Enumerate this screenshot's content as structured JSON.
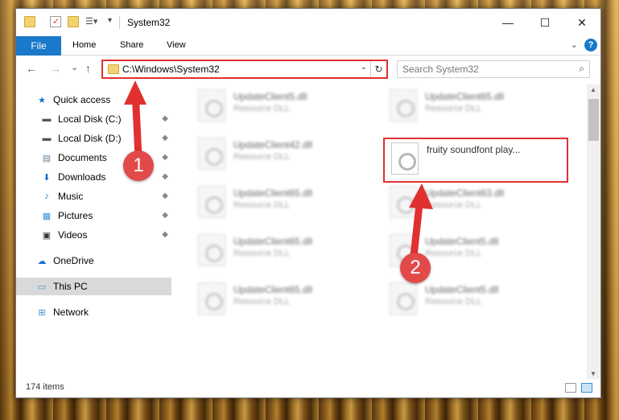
{
  "window": {
    "title": "System32",
    "controls": {
      "minimize": "—",
      "maximize": "☐",
      "close": "✕"
    }
  },
  "ribbon": {
    "tabs": {
      "file": "File",
      "home": "Home",
      "share": "Share",
      "view": "View"
    },
    "expand_glyph": "⌄",
    "help_glyph": "?"
  },
  "navigation": {
    "back": "←",
    "forward": "→",
    "recent": "⌄",
    "up": "↑",
    "address": "C:\\Windows\\System32",
    "address_dropdown": "⌄",
    "refresh": "↻",
    "search_placeholder": "Search System32",
    "search_glyph": "⌕"
  },
  "sidebar": {
    "items": [
      {
        "label": "Quick access",
        "icon": "star-icon",
        "glyph": "★",
        "color": "#1c6fd1"
      },
      {
        "label": "Local Disk (C:)",
        "icon": "drive-icon",
        "glyph": "▬",
        "color": "#555555",
        "pinned": true
      },
      {
        "label": "Local Disk (D:)",
        "icon": "drive-icon",
        "glyph": "▬",
        "color": "#555555",
        "pinned": true
      },
      {
        "label": "Documents",
        "icon": "document-icon",
        "glyph": "▤",
        "color": "#6a7fa0",
        "pinned": true
      },
      {
        "label": "Downloads",
        "icon": "download-icon",
        "glyph": "⬇",
        "color": "#1c6fd1",
        "pinned": true
      },
      {
        "label": "Music",
        "icon": "music-icon",
        "glyph": "♪",
        "color": "#1c6fd1",
        "pinned": true
      },
      {
        "label": "Pictures",
        "icon": "pictures-icon",
        "glyph": "▦",
        "color": "#3a8fd0",
        "pinned": true
      },
      {
        "label": "Videos",
        "icon": "video-icon",
        "glyph": "▣",
        "color": "#333333",
        "pinned": true
      },
      {
        "label": "OneDrive",
        "icon": "cloud-icon",
        "glyph": "☁",
        "color": "#1c6fd1"
      },
      {
        "label": "This PC",
        "icon": "computer-icon",
        "glyph": "▭",
        "color": "#3a8fd0",
        "selected": true
      },
      {
        "label": "Network",
        "icon": "network-icon",
        "glyph": "⊞",
        "color": "#3a8fd0"
      }
    ],
    "pin_glyph": "📌"
  },
  "files": [
    {
      "name": "UpdateClient5.dll",
      "type": "Resource DLL"
    },
    {
      "name": "UpdateClient65.dll",
      "type": "Resource DLL"
    },
    {
      "name": "UpdateClient42.dll",
      "type": "Resource DLL"
    },
    {
      "name": "fruity soundfont play...",
      "type": ""
    },
    {
      "name": "UpdateClient65.dll",
      "type": "Resource DLL"
    },
    {
      "name": "UpdateClient63.dll",
      "type": "Resource DLL"
    },
    {
      "name": "UpdateClient65.dll",
      "type": "Resource DLL"
    },
    {
      "name": "UpdateClient5.dll",
      "type": "Resource DLL"
    },
    {
      "name": "UpdateClient65.dll",
      "type": "Resource DLL"
    },
    {
      "name": "UpdateClient5.dll",
      "type": "Resource DLL"
    }
  ],
  "status": {
    "item_count": "174 items"
  },
  "annotations": {
    "step1": "1",
    "step2": "2",
    "color": "#e03030"
  },
  "colors": {
    "accent": "#1979ca",
    "highlight_border": "#e03030",
    "selected_nav": "#d9d9d9"
  }
}
